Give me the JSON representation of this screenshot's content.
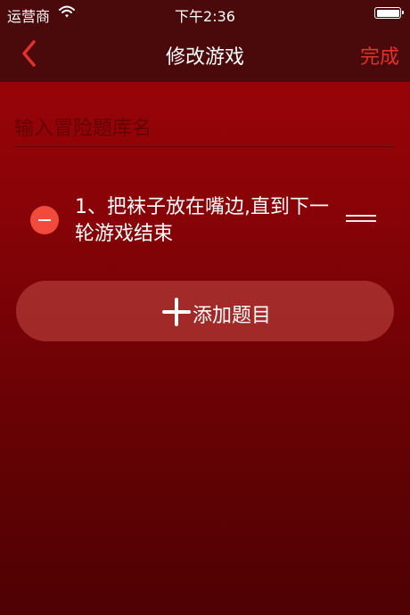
{
  "status_bar": {
    "carrier": "运营商",
    "time": "下午2:36",
    "wifi_icon": "wifi-icon",
    "battery_icon": "battery-icon"
  },
  "nav": {
    "back_icon": "chevron-left-icon",
    "title": "修改游戏",
    "done_label": "完成",
    "accent_color": "#e0322c"
  },
  "form": {
    "name_placeholder": "输入冒险题库名",
    "name_value": ""
  },
  "questions": [
    {
      "text": "1、把袜子放在嘴边,直到下一轮游戏结束",
      "delete_icon": "minus-circle-icon",
      "drag_icon": "drag-handle-icon"
    }
  ],
  "actions": {
    "add_label": "添加题目",
    "add_icon": "plus-icon"
  },
  "colors": {
    "bar_background": "#4a0a0b",
    "delete_red": "#f24a3c"
  }
}
